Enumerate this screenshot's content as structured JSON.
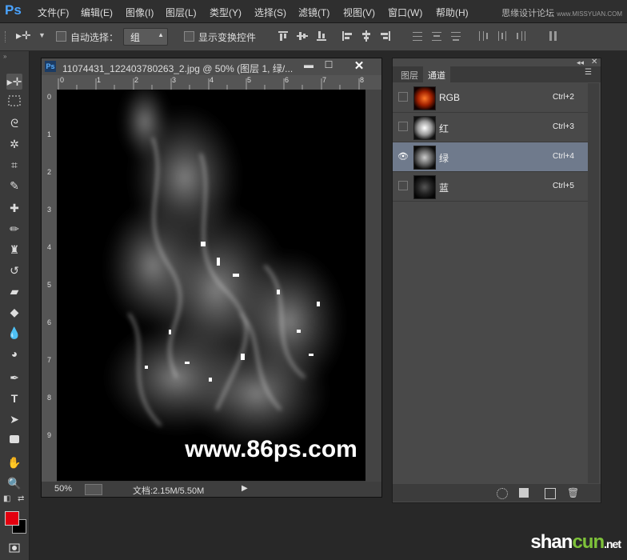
{
  "menubar": {
    "logo": "Ps",
    "items": [
      "文件(F)",
      "编辑(E)",
      "图像(I)",
      "图层(L)",
      "类型(Y)",
      "选择(S)",
      "滤镜(T)",
      "视图(V)",
      "窗口(W)",
      "帮助(H)"
    ],
    "watermark": "思缘设计论坛",
    "watermark_small": "www.MISSYUAN.COM"
  },
  "options": {
    "auto_select_label": "自动选择：",
    "group_value": "组",
    "transform_label": "显示变换控件"
  },
  "document": {
    "title": "11074431_122403780263_2.jpg @ 50% (图层 1, 绿/...",
    "ruler_h": [
      "0",
      "1",
      "2",
      "3",
      "4",
      "5",
      "6",
      "7",
      "8"
    ],
    "ruler_v": [
      "0",
      "1",
      "2",
      "3",
      "4",
      "5",
      "6",
      "7",
      "8",
      "9"
    ],
    "zoom": "50%",
    "doc_info": "文档:2.15M/5.50M",
    "canvas_watermark": "www.86ps.com"
  },
  "panel": {
    "tabs": [
      "图层",
      "通道"
    ],
    "active_tab": "通道",
    "channels": [
      {
        "name": "RGB",
        "shortcut": "Ctrl+2",
        "selected": false
      },
      {
        "name": "红",
        "shortcut": "Ctrl+3",
        "selected": false
      },
      {
        "name": "绿",
        "shortcut": "Ctrl+4",
        "selected": true
      },
      {
        "name": "蓝",
        "shortcut": "Ctrl+5",
        "selected": false
      }
    ]
  },
  "site_watermark": {
    "a": "shan",
    "b": "cun",
    "c": ".net"
  },
  "colors": {
    "foreground": "#e3000f",
    "background": "#000000",
    "selected_row": "#6f7a8c"
  }
}
